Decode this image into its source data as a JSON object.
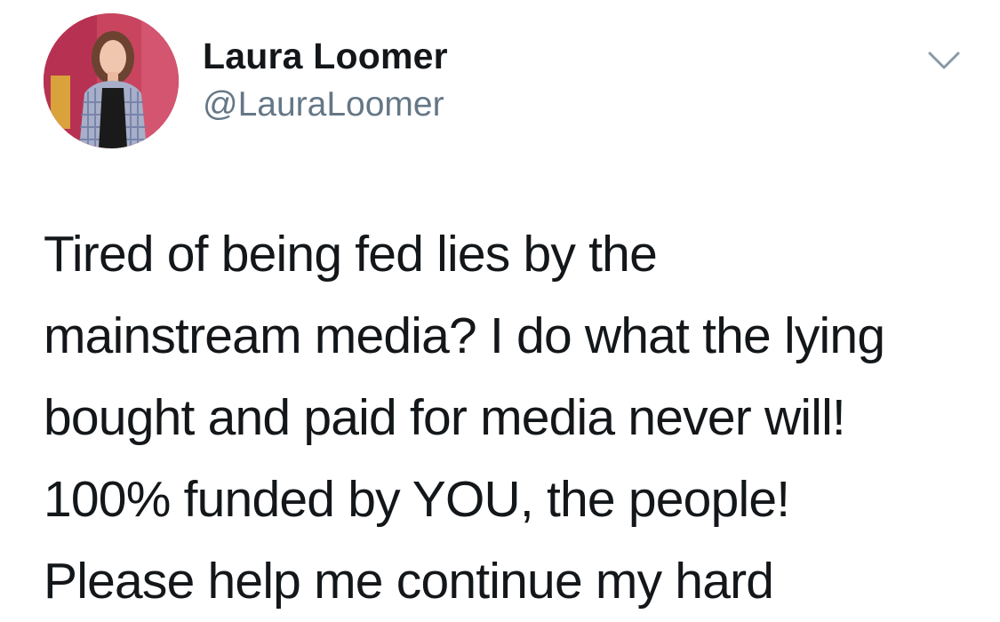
{
  "author": {
    "display_name": "Laura Loomer",
    "handle": "@LauraLoomer"
  },
  "icons": {
    "menu": "chevron-down-icon"
  },
  "tweet": {
    "lines": [
      "Tired of being fed lies by the",
      "mainstream media? I do what the lying",
      "bought and paid for media never will!",
      "100% funded by YOU, the people!",
      "Please help me continue my hard"
    ]
  },
  "colors": {
    "name": "#14171a",
    "handle": "#657786",
    "chevron": "#8899a6"
  }
}
